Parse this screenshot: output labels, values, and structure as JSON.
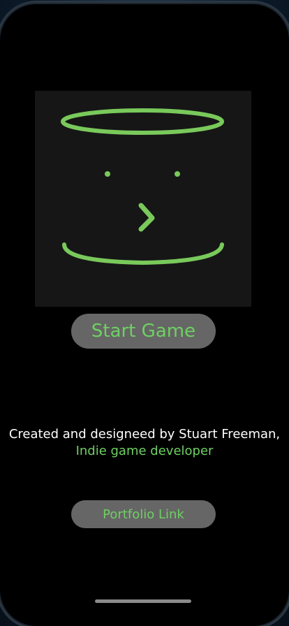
{
  "start_button": {
    "label": "Start Game"
  },
  "credits": {
    "line1": "Created and designeed by Stuart Freeman,",
    "line2": "Indie game developer"
  },
  "portfolio_button": {
    "label": "Portfolio Link"
  },
  "colors": {
    "accent_green": "#6fd063",
    "button_gray": "#666666",
    "background": "#000000"
  },
  "icons": {
    "logo": "cylinder-face-logo"
  }
}
